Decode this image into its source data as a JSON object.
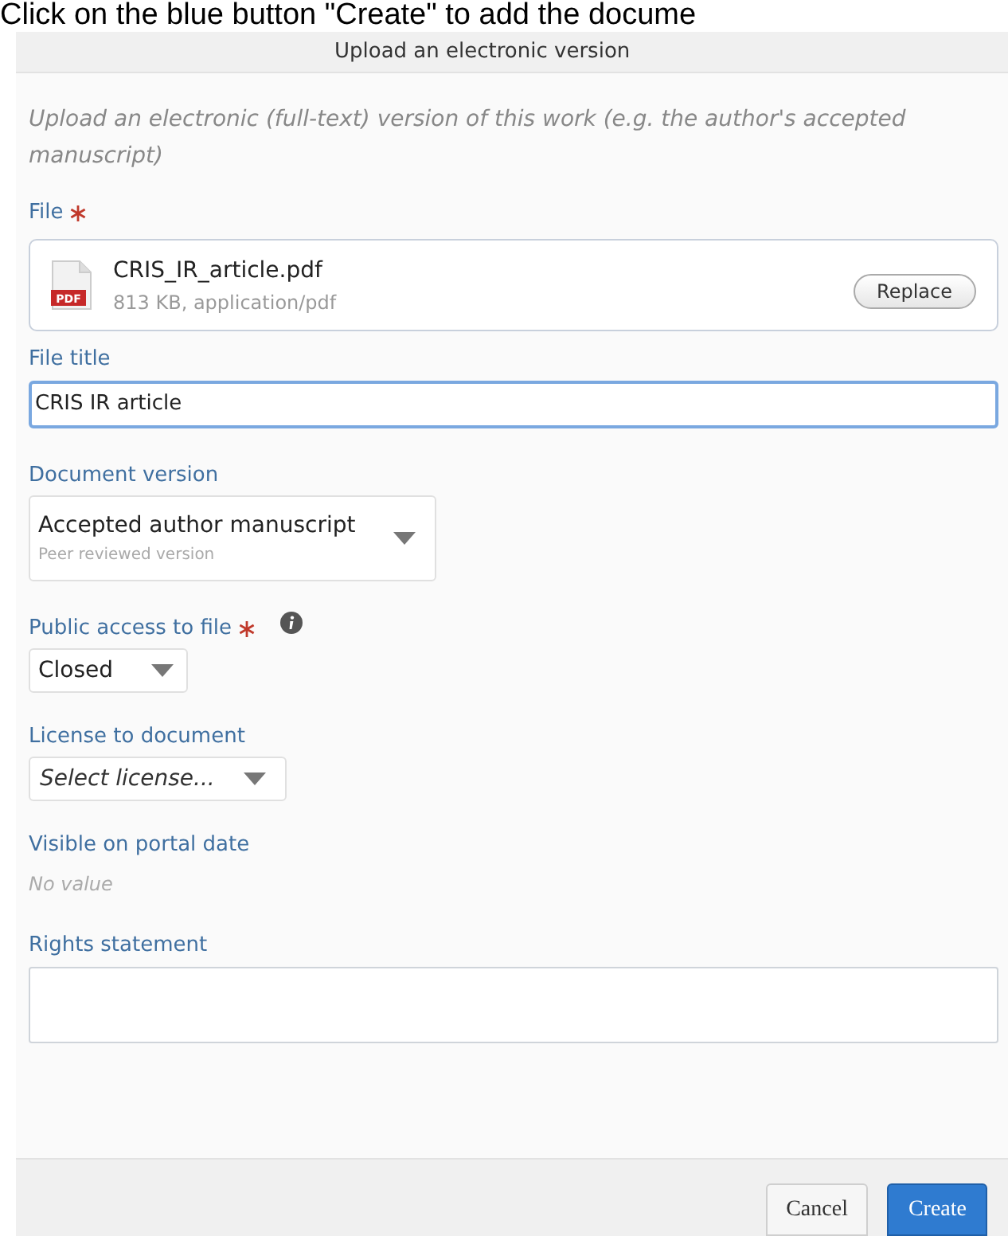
{
  "caption": "Click on the blue button \"Create\" to add the docume",
  "dialog": {
    "title": "Upload an electronic version",
    "description": "Upload an electronic (full-text) version of this work (e.g. the author's accepted manuscript)",
    "file": {
      "label": "File",
      "required": true,
      "name": "CRIS_IR_article.pdf",
      "details": "813 KB, application/pdf",
      "badge": "PDF",
      "button": "Replace"
    },
    "file_title": {
      "label": "File title",
      "value": "CRIS IR article"
    },
    "document_version": {
      "label": "Document version",
      "value": "Accepted author manuscript",
      "hint": "Peer reviewed version"
    },
    "public_access": {
      "label": "Public access to file",
      "required": true,
      "info": true,
      "value": "Closed"
    },
    "license": {
      "label": "License to document",
      "placeholder": "Select license..."
    },
    "visible_date": {
      "label": "Visible on portal date",
      "value": "No value"
    },
    "rights_statement": {
      "label": "Rights statement"
    },
    "buttons": [
      {
        "label": "Cancel",
        "kind": "secondary"
      },
      {
        "label": "Create",
        "kind": "primary"
      }
    ]
  }
}
